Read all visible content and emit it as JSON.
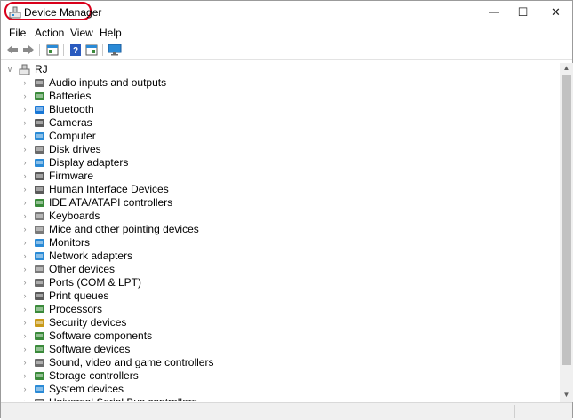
{
  "window": {
    "title": "Device Manager",
    "controls": {
      "minimize": "—",
      "maximize": "☐",
      "close": "✕"
    }
  },
  "menu": [
    "File",
    "Action",
    "View",
    "Help"
  ],
  "toolbar": {
    "buttons": [
      "back-icon",
      "forward-icon",
      "properties-icon",
      "help-icon",
      "update-driver-icon",
      "monitor-icon"
    ]
  },
  "tree": {
    "root": {
      "label": "RJ",
      "expanded": true
    },
    "items": [
      {
        "label": "Audio inputs and outputs",
        "icon": "speaker-icon",
        "color": "#6c6c6c"
      },
      {
        "label": "Batteries",
        "icon": "battery-icon",
        "color": "#3a8a3a"
      },
      {
        "label": "Bluetooth",
        "icon": "bluetooth-icon",
        "color": "#1877d6"
      },
      {
        "label": "Cameras",
        "icon": "camera-icon",
        "color": "#5a5a5a"
      },
      {
        "label": "Computer",
        "icon": "computer-icon",
        "color": "#2a8ad6"
      },
      {
        "label": "Disk drives",
        "icon": "disk-drive-icon",
        "color": "#6a6a6a"
      },
      {
        "label": "Display adapters",
        "icon": "display-adapter-icon",
        "color": "#2a8ad6"
      },
      {
        "label": "Firmware",
        "icon": "firmware-icon",
        "color": "#5a5a5a"
      },
      {
        "label": "Human Interface Devices",
        "icon": "hid-icon",
        "color": "#5a5a5a"
      },
      {
        "label": "IDE ATA/ATAPI controllers",
        "icon": "ide-controller-icon",
        "color": "#3a8a3a"
      },
      {
        "label": "Keyboards",
        "icon": "keyboard-icon",
        "color": "#7a7a7a"
      },
      {
        "label": "Mice and other pointing devices",
        "icon": "mouse-icon",
        "color": "#7a7a7a"
      },
      {
        "label": "Monitors",
        "icon": "monitor-icon",
        "color": "#2a8ad6"
      },
      {
        "label": "Network adapters",
        "icon": "network-adapter-icon",
        "color": "#2a8ad6"
      },
      {
        "label": "Other devices",
        "icon": "other-devices-icon",
        "color": "#7a7a7a"
      },
      {
        "label": "Ports (COM & LPT)",
        "icon": "port-icon",
        "color": "#6a6a6a"
      },
      {
        "label": "Print queues",
        "icon": "printer-icon",
        "color": "#5a5a5a"
      },
      {
        "label": "Processors",
        "icon": "processor-icon",
        "color": "#3a8a3a"
      },
      {
        "label": "Security devices",
        "icon": "security-device-icon",
        "color": "#c99a1a"
      },
      {
        "label": "Software components",
        "icon": "software-component-icon",
        "color": "#3a8a3a"
      },
      {
        "label": "Software devices",
        "icon": "software-device-icon",
        "color": "#3a8a3a"
      },
      {
        "label": "Sound, video and game controllers",
        "icon": "sound-controller-icon",
        "color": "#6c6c6c"
      },
      {
        "label": "Storage controllers",
        "icon": "storage-controller-icon",
        "color": "#3a8a3a"
      },
      {
        "label": "System devices",
        "icon": "system-devices-icon",
        "color": "#2a8ad6"
      },
      {
        "label": "Universal Serial Bus controllers",
        "icon": "usb-controller-icon",
        "color": "#6a6a6a"
      }
    ]
  }
}
